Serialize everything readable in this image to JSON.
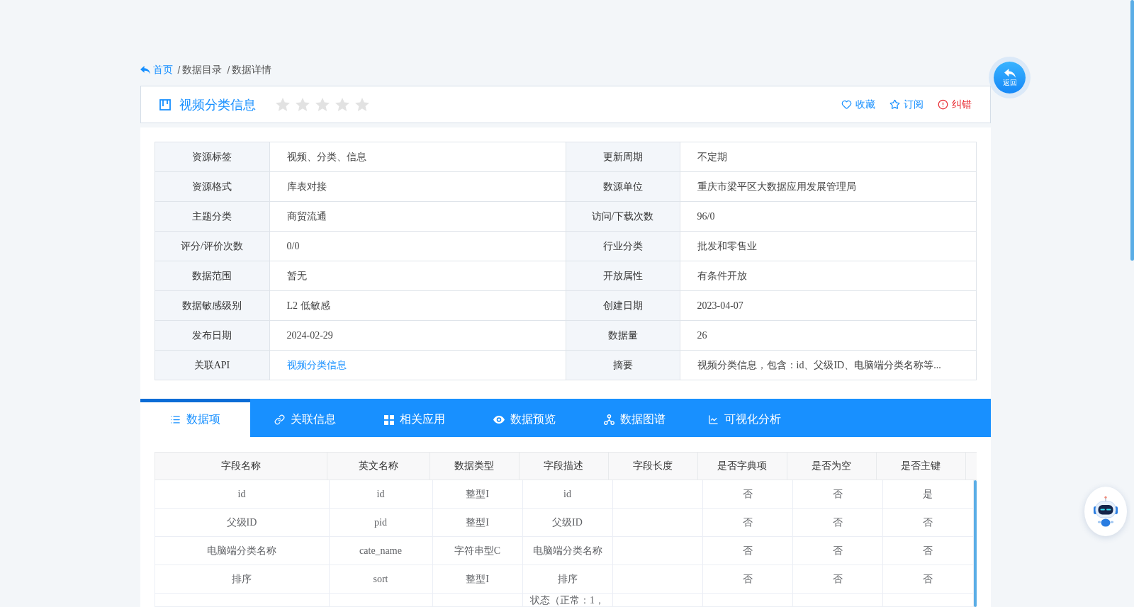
{
  "breadcrumb": {
    "items": [
      {
        "kind": "home",
        "label": "首页"
      },
      {
        "kind": "link",
        "separator": "/",
        "label": "数据目录"
      },
      {
        "kind": "current",
        "separator": "/",
        "label": "数据详情"
      }
    ]
  },
  "back_button": {
    "label": "返回"
  },
  "title_card": {
    "title": "视频分类信息",
    "stars": 0,
    "actions": [
      {
        "kind": "favorite",
        "label": "收藏"
      },
      {
        "kind": "subscribe",
        "label": "订阅"
      },
      {
        "kind": "report",
        "label": "纠错"
      }
    ]
  },
  "info_table": {
    "rows": [
      {
        "fields": [
          {
            "kind": "text",
            "label": "资源标签",
            "value": "视频、分类、信息"
          },
          {
            "kind": "text",
            "label": "更新周期",
            "value": "不定期"
          }
        ]
      },
      {
        "fields": [
          {
            "kind": "text",
            "label": "资源格式",
            "value": "库表对接"
          },
          {
            "kind": "text",
            "label": "数源单位",
            "value": "重庆市梁平区大数据应用发展管理局"
          }
        ]
      },
      {
        "fields": [
          {
            "kind": "text",
            "label": "主题分类",
            "value": "商贸流通"
          },
          {
            "kind": "text",
            "label": "访问/下载次数",
            "value": "96/0"
          }
        ]
      },
      {
        "fields": [
          {
            "kind": "text",
            "label": "评分/评价次数",
            "value": "0/0"
          },
          {
            "kind": "text",
            "label": "行业分类",
            "value": "批发和零售业"
          }
        ]
      },
      {
        "fields": [
          {
            "kind": "text",
            "label": "数据范围",
            "value": "暂无"
          },
          {
            "kind": "text",
            "label": "开放属性",
            "value": "有条件开放"
          }
        ]
      },
      {
        "fields": [
          {
            "kind": "text",
            "label": "数据敏感级别",
            "value": "L2 低敏感"
          },
          {
            "kind": "text",
            "label": "创建日期",
            "value": "2023-04-07"
          }
        ]
      },
      {
        "fields": [
          {
            "kind": "text",
            "label": "发布日期",
            "value": "2024-02-29"
          },
          {
            "kind": "text",
            "label": "数据量",
            "value": "26"
          }
        ]
      },
      {
        "fields": [
          {
            "kind": "link",
            "label": "关联API",
            "value": "视频分类信息"
          },
          {
            "kind": "text",
            "label": "摘要",
            "value": "视频分类信息，包含：id、父级ID、电脑端分类名称等..."
          }
        ]
      }
    ]
  },
  "tabs": [
    {
      "kind": "fields",
      "label": "数据项",
      "selected": true
    },
    {
      "kind": "relations",
      "label": "关联信息",
      "selected": false
    },
    {
      "kind": "apps",
      "label": "相关应用",
      "selected": false
    },
    {
      "kind": "preview",
      "label": "数据预览",
      "selected": false
    },
    {
      "kind": "graph",
      "label": "数据图谱",
      "selected": false
    },
    {
      "kind": "analysis",
      "label": "可视化分析",
      "selected": false
    }
  ],
  "fields_table": {
    "columns": [
      "字段名称",
      "英文名称",
      "数据类型",
      "字段描述",
      "字段长度",
      "是否字典项",
      "是否为空",
      "是否主键"
    ],
    "rows": [
      {
        "name": "id",
        "english_name": "id",
        "data_type": "整型I",
        "description": "id",
        "dictionary": "否",
        "nullable": "否",
        "primary_key": "是"
      },
      {
        "name": "父级ID",
        "english_name": "pid",
        "data_type": "整型I",
        "description": "父级ID",
        "dictionary": "否",
        "nullable": "否",
        "primary_key": "否"
      },
      {
        "name": "电脑端分类名称",
        "english_name": "cate_name",
        "data_type": "字符串型C",
        "description": "电脑端分类名称",
        "dictionary": "否",
        "nullable": "否",
        "primary_key": "否"
      },
      {
        "name": "排序",
        "english_name": "sort",
        "data_type": "整型I",
        "description": "排序",
        "dictionary": "否",
        "nullable": "否",
        "primary_key": "否"
      },
      {
        "description": "状态（正常：1，"
      }
    ]
  }
}
